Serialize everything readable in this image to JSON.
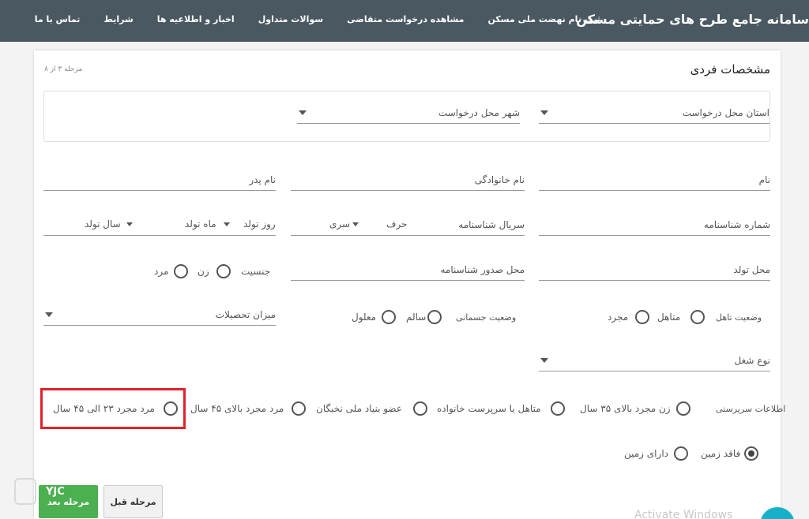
{
  "nav": {
    "brand": "سامانه جامع طرح های حمایتی مسکن",
    "items": [
      "ثبت نام نهضت ملی مسکن",
      "مشاهده درخواست متقاضی",
      "سوالات متداول",
      "اخبار و اطلاعیه ها",
      "شرایط",
      "تماس با ما"
    ]
  },
  "form": {
    "title": "مشخصات فردی",
    "step": "مرحله ۳ از ۸",
    "province": "استان محل درخواست",
    "city": "شهر محل درخواست",
    "first_name": "نام",
    "last_name": "نام خانوادگی",
    "father_name": "نام پدر",
    "id_number": "شماره شناسنامه",
    "id_serial": "سریال شناسنامه",
    "letter": "حرف",
    "series": "سری",
    "birth_day": "روز تولد",
    "birth_month": "ماه تولد",
    "birth_year": "سال تولد",
    "birth_place": "محل تولد",
    "issue_place": "محل صدور شناسنامه",
    "gender": "جنسیت",
    "female": "زن",
    "male": "مرد",
    "marital": "وضعیت تاهل",
    "married": "متاهل",
    "single": "مجرد",
    "physical": "وضعیت جسمانی",
    "healthy": "سالم",
    "disabled": "معلول",
    "education": "میزان تحصیلات",
    "job": "نوع شغل",
    "guardianship": "اطلاعات سرپرستی",
    "opt_woman35": "زن مجرد بالای ۳۵ سال",
    "opt_married_head": "متاهل یا سرپرست خانواده",
    "opt_elite": "عضو بنیاد ملی نخبگان",
    "opt_man45": "مرد مجرد بالای ۴۵ سال",
    "opt_man23_45": "مرد مجرد ۲۳ الی ۴۵ سال",
    "no_land": "فاقد زمین",
    "has_land": "دارای زمین",
    "next": "مرحله بعد",
    "prev": "مرحله قبل"
  },
  "overlay": {
    "watermark": "YJC",
    "activate": "Activate Windows"
  },
  "colors": {
    "topbar": "#4a5861",
    "highlight": "#e2212b",
    "next_button": "#4caf50"
  }
}
